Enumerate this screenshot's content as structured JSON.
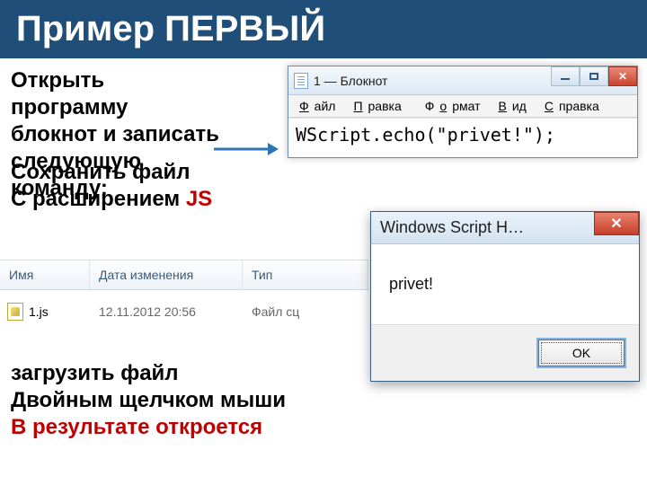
{
  "title": "Пример ПЕРВЫЙ",
  "step1": {
    "l1": "Открыть",
    "l2": "программу",
    "l3": "блокнот и записать",
    "l4": "следующую",
    "l5": "команду:"
  },
  "step2": {
    "l1": "Сохранить файл",
    "l2_a": "С расширением ",
    "l2_b": "JS"
  },
  "step3": {
    "l1": "загрузить файл",
    "l2": "Двойным щелчком мыши",
    "l3": "В результате откроется"
  },
  "notepad": {
    "title": "1 — Блокнот",
    "menu": {
      "file_u": "Ф",
      "file_r": "айл",
      "edit_u": "П",
      "edit_r": "равка",
      "fmt_pre": "Ф",
      "fmt_u": "о",
      "fmt_r": "рмат",
      "view_u": "В",
      "view_r": "ид",
      "help_u": "С",
      "help_r": "правка"
    },
    "code": "WScript.echo(\"privet!\");"
  },
  "explorer": {
    "cols": {
      "name": "Имя",
      "date": "Дата изменения",
      "type": "Тип"
    },
    "row": {
      "name": "1.js",
      "date": "12.11.2012 20:56",
      "type": "Файл сц"
    }
  },
  "wsh": {
    "title": "Windows Script H…",
    "message": "privet!",
    "ok": "OK"
  }
}
